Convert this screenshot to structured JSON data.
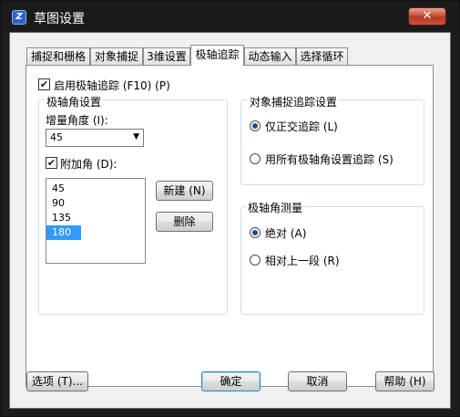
{
  "window": {
    "title": "草图设置",
    "close_glyph": "✕",
    "app_icon_glyph": "Z"
  },
  "tabs": [
    {
      "label": "捕捉和栅格",
      "active": false
    },
    {
      "label": "对象捕捉",
      "active": false
    },
    {
      "label": "3维设置",
      "active": false
    },
    {
      "label": "极轴追踪",
      "active": true
    },
    {
      "label": "动态输入",
      "active": false
    },
    {
      "label": "选择循环",
      "active": false
    }
  ],
  "polar": {
    "enable_label": "启用极轴追踪 (F10) (P)",
    "enable_checked": true,
    "angle_group_title": "极轴角设置",
    "increment_label": "增量角度 (I):",
    "increment_value": "45",
    "additional_label": "附加角 (D):",
    "additional_checked": true,
    "angles": [
      "45",
      "90",
      "135",
      "180"
    ],
    "selected_angle": "180",
    "new_button": "新建 (N)",
    "delete_button": "删除"
  },
  "snap_tracking": {
    "group_title": "对象捕捉追踪设置",
    "options": [
      {
        "label": "仅正交追踪 (L)",
        "checked": true
      },
      {
        "label": "用所有极轴角设置追踪 (S)",
        "checked": false
      }
    ]
  },
  "measurement": {
    "group_title": "极轴角测量",
    "options": [
      {
        "label": "绝对 (A)",
        "checked": true
      },
      {
        "label": "相对上一段 (R)",
        "checked": false
      }
    ]
  },
  "footer": {
    "options_button": "选项 (T)...",
    "ok_button": "确定",
    "cancel_button": "取消",
    "help_button": "帮助 (H)"
  },
  "colors": {
    "selection": "#3399ff",
    "panel_bg": "#f0f0f0",
    "titlebar_bg": "#1b1b1b",
    "close_red": "#c9503a"
  }
}
